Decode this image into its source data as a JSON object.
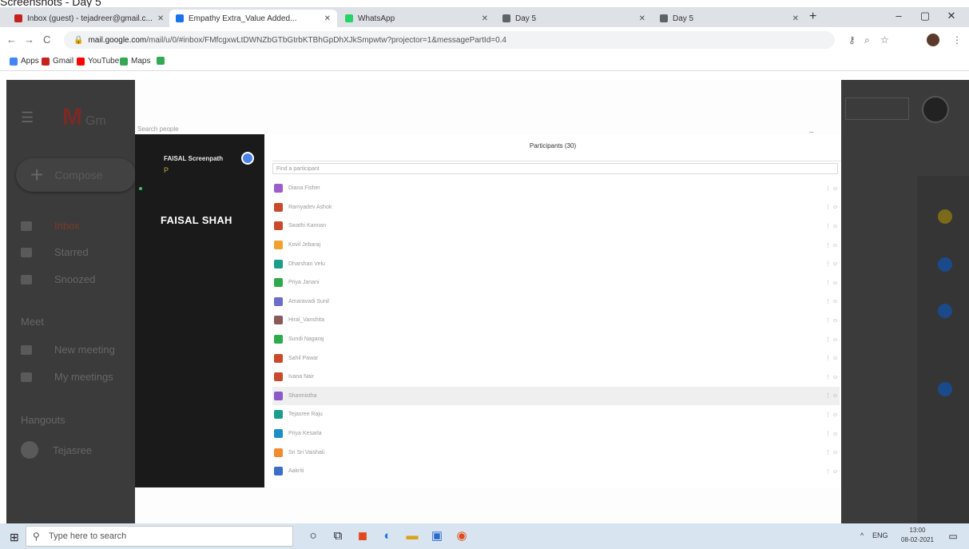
{
  "caption": "Screenshots - Day 5",
  "browser": {
    "tabs": [
      {
        "label": "Inbox (guest) - tejadreer@gmail.c...",
        "favicon_color": "#c5221f",
        "active": false
      },
      {
        "label": "Empathy Extra_Value Added...",
        "favicon_color": "#1a73e8",
        "active": true
      },
      {
        "label": "WhatsApp",
        "favicon_color": "#25d366",
        "active": false
      },
      {
        "label": "Day 5",
        "favicon_color": "#5f6368",
        "active": false
      },
      {
        "label": "Day 5",
        "favicon_color": "#5f6368",
        "active": false
      }
    ],
    "new_tab": "+",
    "window_controls": [
      "–",
      "▢",
      "✕"
    ],
    "nav": {
      "back": "←",
      "forward": "→",
      "reload": "C"
    },
    "url_host": "mail.google.com",
    "url_path": "/mail/u/0/#inbox/FMfcgxwLtDWNZbGTbGtrbKTBhGpDhXJkSmpwtw?projector=1&messagePartId=0.4",
    "bookmarks": [
      {
        "label": "Apps",
        "icon_color": "#4285f4"
      },
      {
        "label": "Gmail",
        "icon_color": "#c5221f"
      },
      {
        "label": "YouTube",
        "icon_color": "#ff0000"
      },
      {
        "label": "Maps",
        "icon_color": "#34a853"
      },
      {
        "label": "",
        "icon_color": "#34a853"
      }
    ]
  },
  "gmail": {
    "logo": "M",
    "logo_suffix": "Gm",
    "compose": "Compose",
    "nav": [
      {
        "label": "Inbox",
        "selected": true
      },
      {
        "label": "Starred",
        "selected": false
      },
      {
        "label": "Snoozed",
        "selected": false
      }
    ],
    "section_meet": "Meet",
    "meet_items": [
      "New meeting",
      "My meetings"
    ],
    "section_hangouts": "Hangouts",
    "hangouts_user": "Tejasree"
  },
  "meet": {
    "search_label": "Search people",
    "close": "–",
    "presenter_name": "FAISAL Screenpath",
    "presenter_sub": "P",
    "main_name": "FAISAL SHAH",
    "participants_title": "Participants (30)",
    "search_placeholder": "Find a participant",
    "participants": [
      {
        "name": "Diana Fisher",
        "color": "#9c5fc9",
        "hl": false
      },
      {
        "name": "Ramyadev Ashok",
        "color": "#c94a2b",
        "hl": false
      },
      {
        "name": "Swathi Kannan",
        "color": "#c94a2b",
        "hl": false
      },
      {
        "name": "Kovil Jebaraj",
        "color": "#f2a030",
        "hl": false
      },
      {
        "name": "Dharshan Velu",
        "color": "#1a9e8a",
        "hl": false
      },
      {
        "name": "Priya Janani",
        "color": "#2eaa4a",
        "hl": false
      },
      {
        "name": "Amaravadi Sunil",
        "color": "#6c6cc9",
        "hl": false
      },
      {
        "name": "Hiral_Vanshita",
        "color": "#8a5a5a",
        "hl": false
      },
      {
        "name": "Sundi Nagaraj",
        "color": "#2eaa4a",
        "hl": false
      },
      {
        "name": "Sahil Pawar",
        "color": "#c94a2b",
        "hl": false
      },
      {
        "name": "Ivana Nair",
        "color": "#c94a2b",
        "hl": false
      },
      {
        "name": "Sharmistha",
        "color": "#8a5ac9",
        "hl": true
      },
      {
        "name": "Tejasree Raju",
        "color": "#1a9e8a",
        "hl": false
      },
      {
        "name": "Priya Kesarla",
        "color": "#1a8ec9",
        "hl": false
      },
      {
        "name": "Sri Sri Vaishali",
        "color": "#f28a30",
        "hl": false
      },
      {
        "name": "Aakriti",
        "color": "#3a6ec9",
        "hl": false
      }
    ],
    "row_actions": "⋮ ☺"
  },
  "taskbar": {
    "search_placeholder": "Type here to search",
    "tray_lang": "ENG",
    "tray_arrow": "^",
    "time": "13:00",
    "date": "08-02-2021"
  }
}
